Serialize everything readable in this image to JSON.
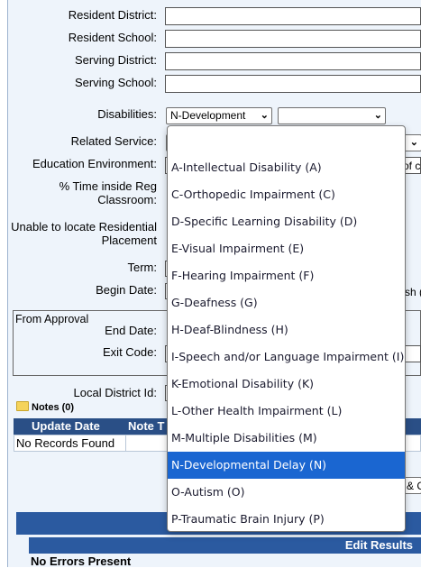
{
  "labels": {
    "resident_district": "Resident District:",
    "resident_school": "Resident School:",
    "serving_district": "Serving District:",
    "serving_school": "Serving School:",
    "disabilities": "Disabilities:",
    "related_service": "Related Service:",
    "education_environment": "Education Environment:",
    "pct_time": "% Time inside Reg Classroom:",
    "unable_locate": "Unable to locate Residential Placement",
    "term": "Term:",
    "begin_date": "Begin Date:",
    "end_date": "End Date:",
    "exit_code": "Exit Code:",
    "local_district_id": "Local District Id:"
  },
  "approval_legend": "From Approval",
  "disabilities_select": {
    "value": "N-Development"
  },
  "partial_text": {
    "education_environment_tail": "of c",
    "begin_date_tail": "sh (",
    "notes_tail": "& C"
  },
  "notes": {
    "title": "Notes (0)",
    "columns": [
      "Update Date",
      "Note T"
    ],
    "empty_message": "No Records Found"
  },
  "edit_results": {
    "title": "Edit Results",
    "message": "No Errors Present"
  },
  "dropdown": {
    "selected_index": 12,
    "options": [
      "",
      "A-Intellectual Disability (A)",
      "C-Orthopedic Impairment (C)",
      "D-Specific Learning Disability (D)",
      "E-Visual Impairment (E)",
      "F-Hearing Impairment (F)",
      "G-Deafness (G)",
      "H-Deaf-Blindness (H)",
      "I-Speech and/or Language Impairment (I)",
      "K-Emotional Disability (K)",
      "L-Other Health Impairment (L)",
      "M-Multiple Disabilities (M)",
      "N-Developmental Delay (N)",
      "O-Autism (O)",
      "P-Traumatic Brain Injury (P)"
    ]
  },
  "colors": {
    "header_blue": "#2a4f86",
    "bar_blue": "#2b5aa0",
    "selection_blue": "#1a66d1",
    "panel_bg": "#eef4fb"
  }
}
